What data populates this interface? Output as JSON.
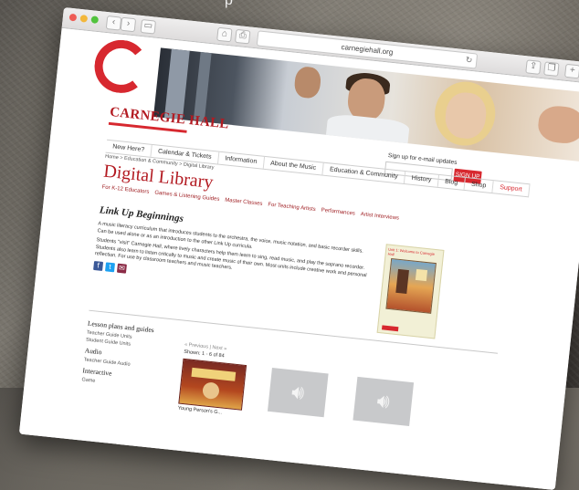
{
  "browser": {
    "url": "carnegiehall.org"
  },
  "brand": {
    "name": "CARNEGIE HALL",
    "accent": "#d7282f"
  },
  "signup": {
    "label": "Sign up for e-mail updates",
    "button": "SIGN UP"
  },
  "topnav": [
    "New Here?",
    "Calendar & Tickets",
    "Information",
    "About the Music",
    "Education & Community",
    "History",
    "Blog",
    "Shop",
    "Support"
  ],
  "breadcrumb": "Home > Education & Community > Digital Library",
  "section_title": "Digital Library",
  "subnav": [
    "For K-12 Educators",
    "Games & Listening Guides",
    "Master Classes",
    "For Teaching Artists",
    "Performances",
    "Artist Interviews"
  ],
  "page_title": "Link Up Beginnings",
  "paragraphs": [
    "A music literacy curriculum that introduces students to the orchestra, the voice, music notation, and basic recorder skills. Can be used alone or as an introduction to the other Link Up curricula.",
    "Students \"visit\" Carnegie Hall, where lively characters help them learn to sing, read music, and play the soprano recorder. Students also learn to listen critically to music and create music of their own. Most units include creative work and personal reflection. For use by classroom teachers and music teachers."
  ],
  "thumb_title": "Unit 1: Welcome to Carnegie Hall",
  "sidebar": {
    "lesson_heading": "Lesson plans and guides",
    "lesson_links": [
      "Teacher Guide Units",
      "Student Guide Units"
    ],
    "audio_heading": "Audio",
    "audio_links": [
      "Teacher Guide Audio"
    ],
    "interactive_heading": "Interactive",
    "interactive_links": [
      "Game"
    ]
  },
  "results": {
    "pager": "« Previous | Next »",
    "shown": "Shown: 1 - 6 of 84",
    "first_caption": "Young Person's G..."
  }
}
